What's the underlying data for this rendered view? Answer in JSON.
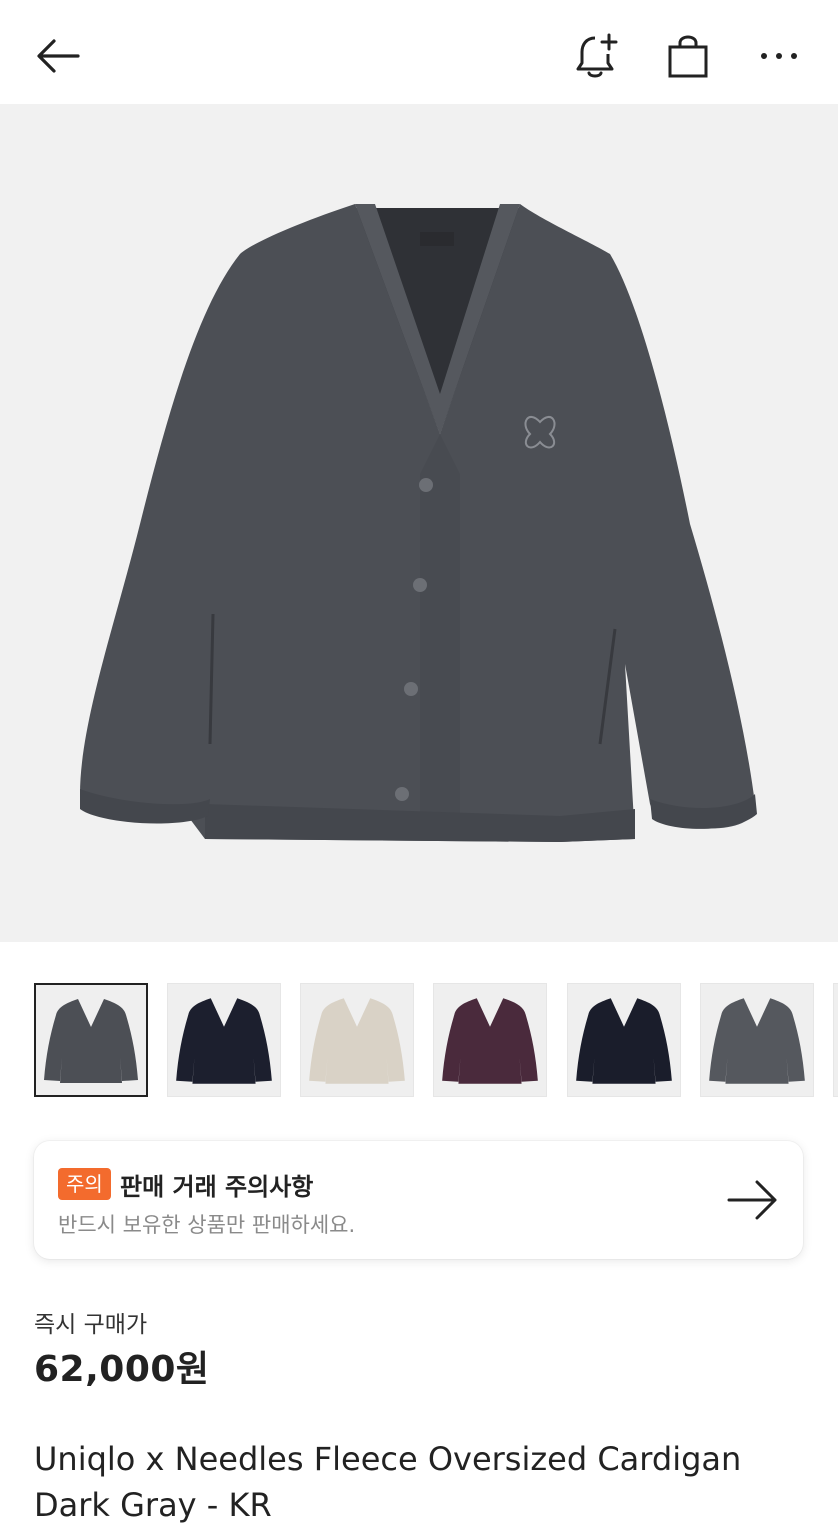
{
  "header": {
    "back_icon": "arrow-left-icon",
    "bell_icon": "bell-plus-icon",
    "bag_icon": "shopping-bag-icon",
    "more_icon": "more-horizontal-icon"
  },
  "gallery": {
    "thumbnails": [
      {
        "color": "#4c4f55",
        "selected": true
      },
      {
        "color": "#1c1f2e",
        "selected": false
      },
      {
        "color": "#d9d2c6",
        "selected": false
      },
      {
        "color": "#4a2a3c",
        "selected": false
      },
      {
        "color": "#1a1d2b",
        "selected": false
      },
      {
        "color": "#55585e",
        "selected": false
      }
    ]
  },
  "notice": {
    "badge": "주의",
    "title": "판매 거래 주의사항",
    "subtitle": "반드시 보유한 상품만 판매하세요.",
    "arrow_icon": "arrow-right-icon"
  },
  "price": {
    "label": "즉시 구매가",
    "value": "62,000원"
  },
  "product": {
    "title": "Uniqlo x Needles Fleece Oversized Cardigan Dark Gray - KR"
  },
  "colors": {
    "accent": "#f36b2d",
    "hero_bg": "#f1f1f1",
    "garment": "#4c4f55"
  }
}
